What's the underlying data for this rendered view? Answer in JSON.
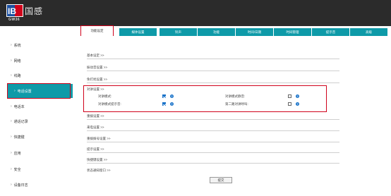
{
  "brand": {
    "name": "国感",
    "model": "GW36"
  },
  "sidebar": {
    "items": [
      {
        "label": "系统"
      },
      {
        "label": "网络"
      },
      {
        "label": "线路"
      },
      {
        "label": "电话设置"
      },
      {
        "label": "电话本"
      },
      {
        "label": "通话记录"
      },
      {
        "label": "快捷键"
      },
      {
        "label": "应用"
      },
      {
        "label": "安全"
      },
      {
        "label": "设备日志"
      }
    ],
    "active_index": 3
  },
  "tabs": [
    {
      "label": "功能设定"
    },
    {
      "label": "媒体设置"
    },
    {
      "label": "铃声"
    },
    {
      "label": "功能"
    },
    {
      "label": "时间/日期"
    },
    {
      "label": "时间管理"
    },
    {
      "label": "提示音"
    },
    {
      "label": "高级"
    }
  ],
  "sections": [
    {
      "label": "基本设定 >>"
    },
    {
      "label": "振动音设置 >>"
    },
    {
      "label": "免打扰设置 >>"
    }
  ],
  "intercom": {
    "title": "对讲设置 >>",
    "fields": {
      "intercom_mode": {
        "label": "对讲模式:",
        "checked": true
      },
      "intercom_mute": {
        "label": "对讲模式静音:",
        "checked": false
      },
      "intercom_tone": {
        "label": "对讲模式提示音:",
        "checked": true
      },
      "second_intercom": {
        "label": "第二路对讲呼叫:",
        "checked": false
      }
    },
    "help_glyph": "?"
  },
  "sections_after": [
    {
      "label": "重拨设置 >>"
    },
    {
      "label": "来电设置 >>"
    },
    {
      "label": "重拨拨号设置 >>"
    },
    {
      "label": "提示设置 >>"
    },
    {
      "label": "快捷键设置 >>"
    },
    {
      "label": "状态通知窗口 >>"
    }
  ],
  "submit": {
    "label": "提交"
  },
  "colors": {
    "accent": "#0e9aa8",
    "highlight": "#d0021b",
    "checkbox": "#1a73c9",
    "topbar": "#2b2b2b"
  }
}
